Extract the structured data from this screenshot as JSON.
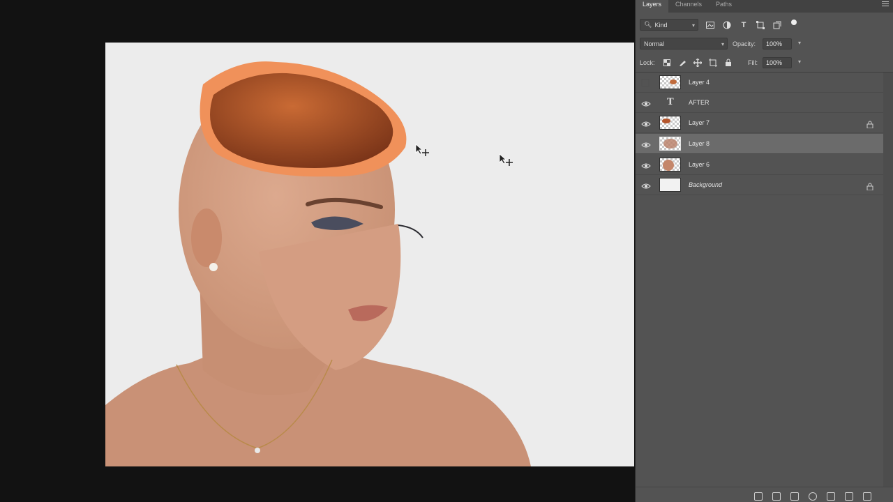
{
  "panel": {
    "tabs": [
      "Layers",
      "Channels",
      "Paths"
    ],
    "active_tab": "Layers",
    "filter": {
      "label": "Kind"
    },
    "blend_mode": "Normal",
    "opacity_label": "Opacity:",
    "opacity_value": "100%",
    "lock_label": "Lock:",
    "fill_label": "Fill:",
    "fill_value": "100%"
  },
  "layers": [
    {
      "name": "Layer 4",
      "visible": false,
      "type": "image",
      "locked": false,
      "selected": false
    },
    {
      "name": "AFTER",
      "visible": true,
      "type": "text",
      "locked": false,
      "selected": false
    },
    {
      "name": "Layer 7",
      "visible": true,
      "type": "image",
      "locked": true,
      "selected": false
    },
    {
      "name": "Layer 8",
      "visible": true,
      "type": "image",
      "locked": false,
      "selected": true
    },
    {
      "name": "Layer 6",
      "visible": true,
      "type": "image",
      "locked": false,
      "selected": false
    },
    {
      "name": "Background",
      "visible": true,
      "type": "background",
      "locked": true,
      "selected": false
    }
  ],
  "colors": {
    "panel_bg": "#535353",
    "canvas_bg": "#ececec",
    "selected_row": "#6b6b6b",
    "workspace_bg": "#121212"
  }
}
